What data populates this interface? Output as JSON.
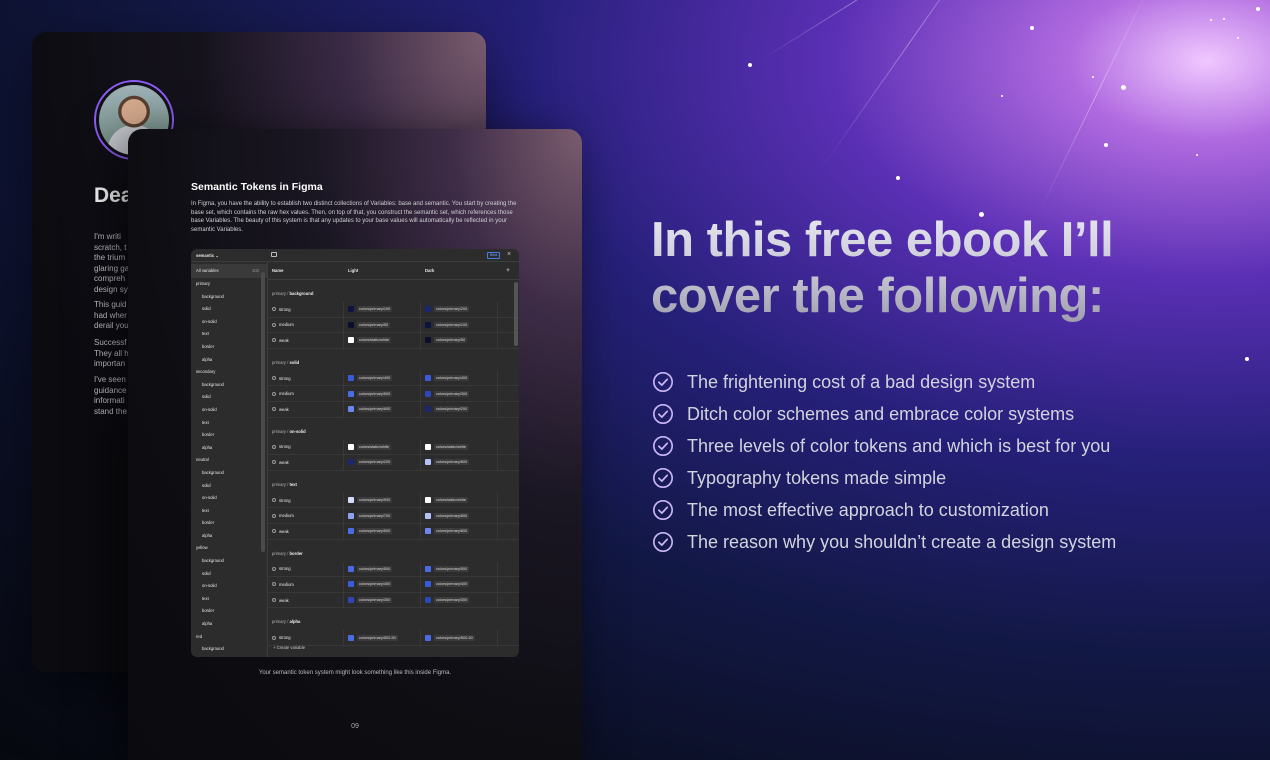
{
  "back_page": {
    "heading": "Dea",
    "paragraphs": [
      [
        "I'm writi",
        "scratch, t",
        "the trium",
        "glaring ga",
        "compreh",
        "design sy"
      ],
      [
        "This guid",
        "had wher",
        "derail you"
      ],
      [
        "Successf",
        "They all h",
        "importan"
      ],
      [
        "I've seen",
        "guidance",
        "informati",
        "stand the"
      ]
    ]
  },
  "front_page": {
    "title": "Semantic Tokens in Figma",
    "body": "In Figma, you have the ability to establish two distinct collections of Variables: base and semantic. You start by creating the base set, which contains the raw hex values. Then, on top of that, you construct the semantic set, which references those base Variables. The beauty of this system is that any updates to your base values will automatically be reflected in your semantic Variables.",
    "caption": "Your semantic token system might look something like this inside Figma.",
    "page_number": "09"
  },
  "figma": {
    "collection": "semantic",
    "beta_label": "Beta",
    "all_variables": "All variables",
    "all_count": "102",
    "columns": [
      "Name",
      "Light",
      "Dark"
    ],
    "create_label": "Create variable",
    "sidebar": [
      {
        "label": "primary",
        "level": 0
      },
      {
        "label": "background",
        "level": 1
      },
      {
        "label": "solid",
        "level": 1
      },
      {
        "label": "on-solid",
        "level": 1
      },
      {
        "label": "text",
        "level": 1
      },
      {
        "label": "border",
        "level": 1
      },
      {
        "label": "alpha",
        "level": 1
      },
      {
        "label": "secondary",
        "level": 0
      },
      {
        "label": "background",
        "level": 1
      },
      {
        "label": "solid",
        "level": 1
      },
      {
        "label": "on-solid",
        "level": 1
      },
      {
        "label": "text",
        "level": 1
      },
      {
        "label": "border",
        "level": 1
      },
      {
        "label": "alpha",
        "level": 1
      },
      {
        "label": "neutral",
        "level": 0
      },
      {
        "label": "background",
        "level": 1
      },
      {
        "label": "solid",
        "level": 1
      },
      {
        "label": "on-solid",
        "level": 1
      },
      {
        "label": "text",
        "level": 1
      },
      {
        "label": "border",
        "level": 1
      },
      {
        "label": "alpha",
        "level": 1
      },
      {
        "label": "yellow",
        "level": 0
      },
      {
        "label": "background",
        "level": 1
      },
      {
        "label": "solid",
        "level": 1
      },
      {
        "label": "on-solid",
        "level": 1
      },
      {
        "label": "text",
        "level": 1
      },
      {
        "label": "border",
        "level": 1
      },
      {
        "label": "alpha",
        "level": 1
      },
      {
        "label": "red",
        "level": 0
      },
      {
        "label": "background",
        "level": 1
      }
    ],
    "groups": [
      {
        "prefix": "primary / ",
        "name": "background",
        "rows": [
          {
            "name": "strong",
            "light": "colors/primary/100",
            "light_color": "#0d1442",
            "dark": "colors/primary/200",
            "dark_color": "#1a2670"
          },
          {
            "name": "medium",
            "light": "colors/primary/50",
            "light_color": "#0a0f2e",
            "dark": "colors/primary/100",
            "dark_color": "#0d1442"
          },
          {
            "name": "weak",
            "light": "colors/static/white",
            "light_color": "#ffffff",
            "dark": "colors/primary/50",
            "dark_color": "#0a0f2e"
          }
        ]
      },
      {
        "prefix": "primary / ",
        "name": "solid",
        "rows": [
          {
            "name": "strong",
            "light": "colors/primary/400",
            "light_color": "#3a5bd9",
            "dark": "colors/primary/400",
            "dark_color": "#3a5bd9"
          },
          {
            "name": "medium",
            "light": "colors/primary/500",
            "light_color": "#4a6be6",
            "dark": "colors/primary/300",
            "dark_color": "#2c48b8"
          },
          {
            "name": "weak",
            "light": "colors/primary/600",
            "light_color": "#6b86ee",
            "dark": "colors/primary/200",
            "dark_color": "#1a2670"
          }
        ]
      },
      {
        "prefix": "primary / ",
        "name": "on-solid",
        "rows": [
          {
            "name": "strong",
            "light": "colors/static/white",
            "light_color": "#ffffff",
            "dark": "colors/static/white",
            "dark_color": "#ffffff"
          },
          {
            "name": "weak",
            "light": "colors/primary/200",
            "light_color": "#1a2670",
            "dark": "colors/primary/800",
            "dark_color": "#b3c1f7"
          }
        ]
      },
      {
        "prefix": "primary / ",
        "name": "text",
        "rows": [
          {
            "name": "strong",
            "light": "colors/primary/900",
            "light_color": "#d4dcfb",
            "dark": "colors/static/white",
            "dark_color": "#ffffff"
          },
          {
            "name": "medium",
            "light": "colors/primary/700",
            "light_color": "#8ea2f2",
            "dark": "colors/primary/800",
            "dark_color": "#b3c1f7"
          },
          {
            "name": "weak",
            "light": "colors/primary/500",
            "light_color": "#4a6be6",
            "dark": "colors/primary/600",
            "dark_color": "#6b86ee"
          }
        ]
      },
      {
        "prefix": "primary / ",
        "name": "border",
        "rows": [
          {
            "name": "strong",
            "light": "colors/primary/500",
            "light_color": "#4a6be6",
            "dark": "colors/primary/500",
            "dark_color": "#4a6be6"
          },
          {
            "name": "medium",
            "light": "colors/primary/400",
            "light_color": "#3a5bd9",
            "dark": "colors/primary/400",
            "dark_color": "#3a5bd9"
          },
          {
            "name": "weak",
            "light": "colors/primary/300",
            "light_color": "#2c48b8",
            "dark": "colors/primary/300",
            "dark_color": "#2c48b8"
          }
        ]
      },
      {
        "prefix": "primary / ",
        "name": "alpha",
        "rows": [
          {
            "name": "strong",
            "light": "colors/primary/500-50",
            "light_color": "#4a6be6",
            "dark": "colors/primary/500-50",
            "dark_color": "#4a6be6"
          }
        ]
      }
    ]
  },
  "headline": "In this free ebook I’ll cover the following:",
  "features": [
    "The frightening cost of a bad design system",
    "Ditch color schemes and embrace color systems",
    "Three levels of color tokens and which is best for you",
    "Typography tokens made simple",
    "The most effective approach to customization",
    "The reason why you shouldn’t create a design system"
  ],
  "colors": {
    "check_accent": "#c9b6f5",
    "headline_light": "#e8e8f2",
    "bg_purple": "#5a2fb4"
  }
}
